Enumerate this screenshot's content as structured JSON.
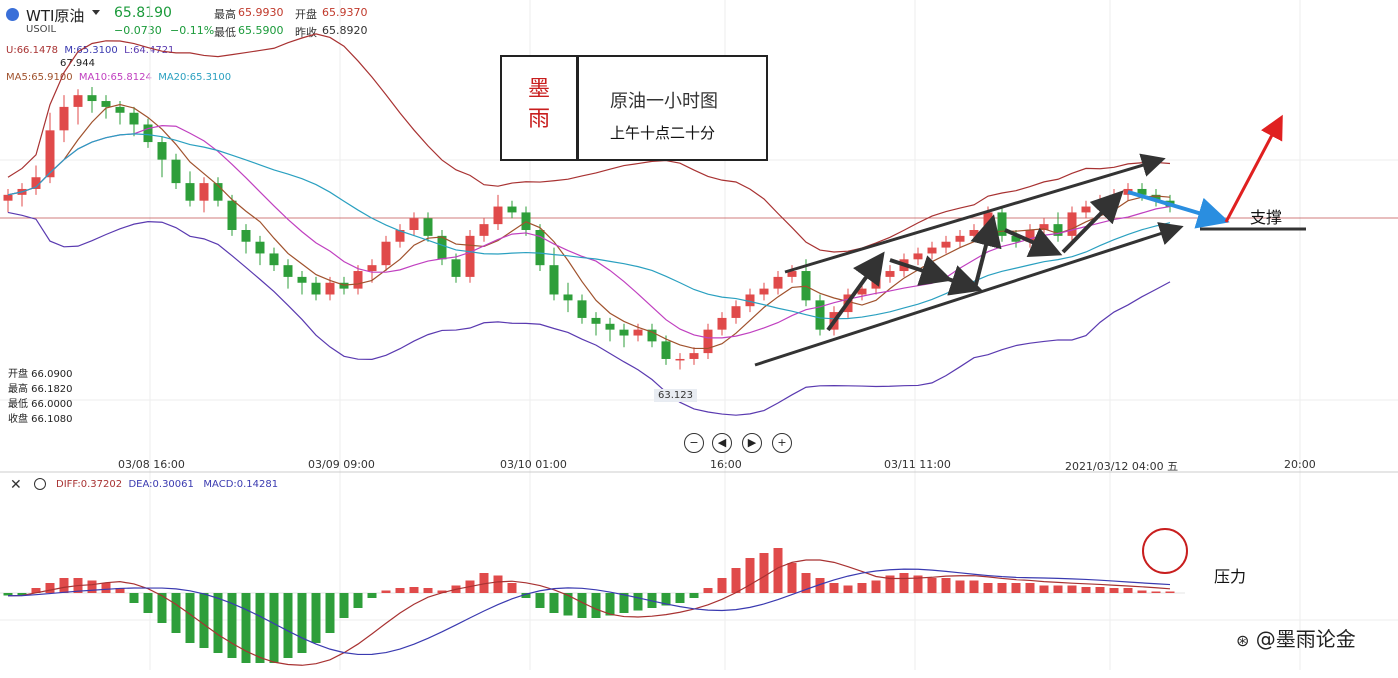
{
  "header": {
    "name": "WTI原油",
    "symbol": "USOIL",
    "price": "65.8190",
    "change": "−0.0730",
    "change_pct": "−0.11%",
    "high_label": "最高",
    "high": "65.9930",
    "open_label": "开盘",
    "open": "65.9370",
    "low_label": "最低",
    "low": "65.5900",
    "prev_label": "昨收",
    "prev": "65.8920"
  },
  "boll": {
    "u": "U:66.1478",
    "m": "M:65.3100",
    "l": "L:64.4721"
  },
  "ma": {
    "ma5": "MA5:65.9100",
    "ma10": "MA10:65.8124",
    "ma20": "MA20:65.3100"
  },
  "top_mark": "67.944",
  "bottom_mark": "63.123",
  "ohlc": [
    "开盘 66.0900",
    "最高 66.1820",
    "最低 66.0000",
    "收盘 66.1080"
  ],
  "xticks": [
    "03/08 16:00",
    "03/09 09:00",
    "03/10 01:00",
    "16:00",
    "03/11 11:00",
    "2021/03/12 04:00 五",
    "20:00"
  ],
  "macd": {
    "diff": "DIFF:0.37202",
    "dea": "DEA:0.30061",
    "macd": "MACD:0.14281"
  },
  "title_box": {
    "brand": "墨雨",
    "title": "原油一小时图",
    "subtitle": "上午十点二十分"
  },
  "annotations": {
    "support": "支撑",
    "pressure": "压力"
  },
  "watermark": "@墨雨论金",
  "colors": {
    "up": "#e04a4a",
    "down": "#2e9e3a",
    "boll": "#a83232",
    "boll_low": "#5a3ab0",
    "ma5": "#a0522d",
    "ma10": "#c040c0",
    "ma20": "#2aa0c0"
  },
  "icons": [
    "usoil-icon",
    "dropdown-icon",
    "close-icon",
    "settings-icon",
    "zoom-out-icon",
    "prev-icon",
    "next-icon",
    "zoom-in-icon",
    "weibo-icon"
  ],
  "chart_data": {
    "type": "candlestick",
    "title": "原油一小时图",
    "xlabel": "",
    "ylabel": "",
    "ylim": [
      62.6,
      68.4
    ],
    "candles": [
      [
        66.0,
        66.2,
        65.8,
        66.1
      ],
      [
        66.1,
        66.3,
        65.9,
        66.2
      ],
      [
        66.2,
        66.6,
        66.1,
        66.4
      ],
      [
        66.4,
        67.5,
        66.3,
        67.2
      ],
      [
        67.2,
        67.8,
        67.0,
        67.6
      ],
      [
        67.6,
        67.9,
        67.3,
        67.8
      ],
      [
        67.8,
        67.94,
        67.5,
        67.7
      ],
      [
        67.7,
        67.8,
        67.4,
        67.6
      ],
      [
        67.6,
        67.7,
        67.3,
        67.5
      ],
      [
        67.5,
        67.6,
        67.1,
        67.3
      ],
      [
        67.3,
        67.4,
        66.9,
        67.0
      ],
      [
        67.0,
        67.1,
        66.4,
        66.7
      ],
      [
        66.7,
        66.8,
        66.2,
        66.3
      ],
      [
        66.3,
        66.5,
        65.9,
        66.0
      ],
      [
        66.0,
        66.4,
        65.8,
        66.3
      ],
      [
        66.3,
        66.4,
        65.9,
        66.0
      ],
      [
        66.0,
        66.1,
        65.4,
        65.5
      ],
      [
        65.5,
        65.6,
        65.1,
        65.3
      ],
      [
        65.3,
        65.4,
        64.9,
        65.1
      ],
      [
        65.1,
        65.2,
        64.8,
        64.9
      ],
      [
        64.9,
        65.0,
        64.5,
        64.7
      ],
      [
        64.7,
        64.8,
        64.4,
        64.6
      ],
      [
        64.6,
        64.7,
        64.3,
        64.4
      ],
      [
        64.4,
        64.7,
        64.3,
        64.6
      ],
      [
        64.6,
        64.7,
        64.4,
        64.5
      ],
      [
        64.5,
        64.9,
        64.4,
        64.8
      ],
      [
        64.8,
        65.0,
        64.6,
        64.9
      ],
      [
        64.9,
        65.4,
        64.8,
        65.3
      ],
      [
        65.3,
        65.6,
        65.2,
        65.5
      ],
      [
        65.5,
        65.8,
        65.4,
        65.7
      ],
      [
        65.7,
        65.8,
        65.3,
        65.4
      ],
      [
        65.4,
        65.5,
        64.9,
        65.0
      ],
      [
        65.0,
        65.1,
        64.6,
        64.7
      ],
      [
        64.7,
        65.5,
        64.6,
        65.4
      ],
      [
        65.4,
        65.7,
        65.3,
        65.6
      ],
      [
        65.6,
        66.1,
        65.5,
        65.9
      ],
      [
        65.9,
        66.0,
        65.7,
        65.8
      ],
      [
        65.8,
        65.9,
        65.4,
        65.5
      ],
      [
        65.5,
        65.6,
        64.8,
        64.9
      ],
      [
        64.9,
        65.2,
        64.3,
        64.4
      ],
      [
        64.4,
        64.6,
        64.1,
        64.3
      ],
      [
        64.3,
        64.4,
        63.9,
        64.0
      ],
      [
        64.0,
        64.1,
        63.7,
        63.9
      ],
      [
        63.9,
        64.0,
        63.6,
        63.8
      ],
      [
        63.8,
        63.9,
        63.5,
        63.7
      ],
      [
        63.7,
        63.9,
        63.6,
        63.8
      ],
      [
        63.8,
        63.9,
        63.5,
        63.6
      ],
      [
        63.6,
        63.7,
        63.2,
        63.3
      ],
      [
        63.3,
        63.4,
        63.12,
        63.3
      ],
      [
        63.3,
        63.5,
        63.2,
        63.4
      ],
      [
        63.4,
        63.9,
        63.3,
        63.8
      ],
      [
        63.8,
        64.1,
        63.7,
        64.0
      ],
      [
        64.0,
        64.3,
        63.9,
        64.2
      ],
      [
        64.2,
        64.5,
        64.1,
        64.4
      ],
      [
        64.4,
        64.6,
        64.3,
        64.5
      ],
      [
        64.5,
        64.8,
        64.4,
        64.7
      ],
      [
        64.7,
        64.9,
        64.6,
        64.8
      ],
      [
        64.8,
        65.0,
        64.2,
        64.3
      ],
      [
        64.3,
        64.4,
        63.7,
        63.8
      ],
      [
        63.8,
        64.2,
        63.7,
        64.1
      ],
      [
        64.1,
        64.5,
        64.0,
        64.4
      ],
      [
        64.4,
        64.6,
        64.3,
        64.5
      ],
      [
        64.5,
        64.8,
        64.4,
        64.7
      ],
      [
        64.7,
        64.9,
        64.6,
        64.8
      ],
      [
        64.8,
        65.1,
        64.7,
        65.0
      ],
      [
        65.0,
        65.2,
        64.9,
        65.1
      ],
      [
        65.1,
        65.3,
        65.0,
        65.2
      ],
      [
        65.2,
        65.4,
        65.1,
        65.3
      ],
      [
        65.3,
        65.5,
        65.2,
        65.4
      ],
      [
        65.4,
        65.6,
        65.3,
        65.5
      ],
      [
        65.5,
        65.9,
        65.4,
        65.8
      ],
      [
        65.8,
        65.9,
        65.3,
        65.4
      ],
      [
        65.4,
        65.5,
        65.2,
        65.3
      ],
      [
        65.3,
        65.6,
        65.2,
        65.5
      ],
      [
        65.5,
        65.7,
        65.4,
        65.6
      ],
      [
        65.6,
        65.8,
        65.3,
        65.4
      ],
      [
        65.4,
        65.9,
        65.3,
        65.8
      ],
      [
        65.8,
        66.0,
        65.7,
        65.9
      ],
      [
        65.9,
        66.1,
        65.8,
        66.0
      ],
      [
        66.0,
        66.2,
        65.9,
        66.1
      ],
      [
        66.1,
        66.3,
        66.0,
        66.2
      ],
      [
        66.2,
        66.3,
        66.0,
        66.1
      ],
      [
        66.1,
        66.2,
        65.9,
        66.0
      ],
      [
        66.0,
        66.1,
        65.8,
        65.9
      ]
    ],
    "series": [
      {
        "name": "U",
        "values": []
      },
      {
        "name": "M",
        "values": []
      },
      {
        "name": "L",
        "values": []
      },
      {
        "name": "MA5",
        "values": []
      },
      {
        "name": "MA10",
        "values": []
      },
      {
        "name": "MA20",
        "values": []
      }
    ],
    "macd_hist": [
      -0.05,
      -0.04,
      0.1,
      0.2,
      0.3,
      0.3,
      0.25,
      0.2,
      0.1,
      -0.2,
      -0.4,
      -0.6,
      -0.8,
      -1.0,
      -1.1,
      -1.2,
      -1.3,
      -1.4,
      -1.4,
      -1.4,
      -1.3,
      -1.2,
      -1.0,
      -0.8,
      -0.5,
      -0.3,
      -0.1,
      0.05,
      0.1,
      0.12,
      0.1,
      0.05,
      0.15,
      0.25,
      0.4,
      0.35,
      0.2,
      -0.1,
      -0.3,
      -0.4,
      -0.45,
      -0.5,
      -0.5,
      -0.45,
      -0.4,
      -0.35,
      -0.3,
      -0.25,
      -0.2,
      -0.1,
      0.1,
      0.3,
      0.5,
      0.7,
      0.8,
      0.9,
      0.6,
      0.4,
      0.3,
      0.2,
      0.15,
      0.2,
      0.25,
      0.35,
      0.4,
      0.35,
      0.3,
      0.3,
      0.25,
      0.25,
      0.2,
      0.2,
      0.2,
      0.2,
      0.15,
      0.15,
      0.15,
      0.12,
      0.12,
      0.1,
      0.1,
      0.05,
      0.03,
      0.01
    ]
  }
}
